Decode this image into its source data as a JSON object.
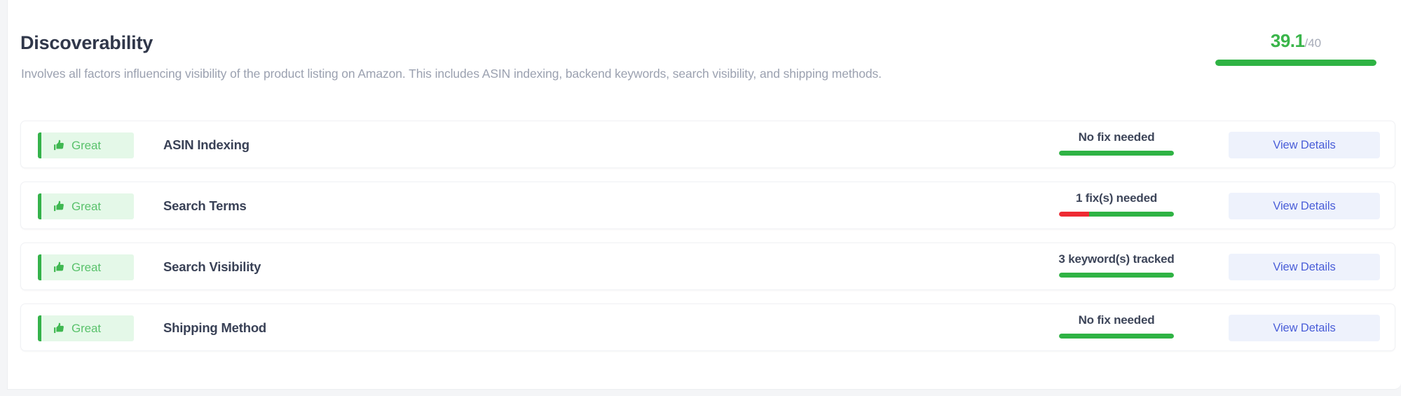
{
  "section": {
    "title": "Discoverability",
    "description": "Involves all factors influencing visibility of the product listing on Amazon. This includes ASIN indexing, backend keywords, search visibility, and shipping methods.",
    "score": {
      "value": "39.1",
      "total": "/40",
      "value_color": "#3ab54a",
      "bar_color": "#2fb344",
      "bar_track_color": "#e9ebef",
      "bar_percent": 100
    }
  },
  "colors": {
    "green": "#2fb344",
    "red": "#ee2b33",
    "badge_bg": "#e4f8e8",
    "badge_border": "#34b24a",
    "badge_text": "#5ac26c",
    "button_bg": "#eef2fc",
    "button_text": "#4a5ed8",
    "title_text": "#30374a",
    "desc_text": "#9ba1b0"
  },
  "button_label": "View Details",
  "rows": [
    {
      "status": "Great",
      "status_icon": "thumbs-up-icon",
      "title": "ASIN Indexing",
      "metric": "No fix needed",
      "bar_segments": [
        {
          "color": "#2fb344",
          "percent": 100
        }
      ],
      "action": "View Details"
    },
    {
      "status": "Great",
      "status_icon": "thumbs-up-icon",
      "title": "Search Terms",
      "metric": "1 fix(s) needed",
      "bar_segments": [
        {
          "color": "#ee2b33",
          "percent": 26
        },
        {
          "color": "#2fb344",
          "percent": 74
        }
      ],
      "action": "View Details"
    },
    {
      "status": "Great",
      "status_icon": "thumbs-up-icon",
      "title": "Search Visibility",
      "metric": "3 keyword(s) tracked",
      "bar_segments": [
        {
          "color": "#2fb344",
          "percent": 100
        }
      ],
      "action": "View Details"
    },
    {
      "status": "Great",
      "status_icon": "thumbs-up-icon",
      "title": "Shipping Method",
      "metric": "No fix needed",
      "bar_segments": [
        {
          "color": "#2fb344",
          "percent": 100
        }
      ],
      "action": "View Details"
    }
  ]
}
